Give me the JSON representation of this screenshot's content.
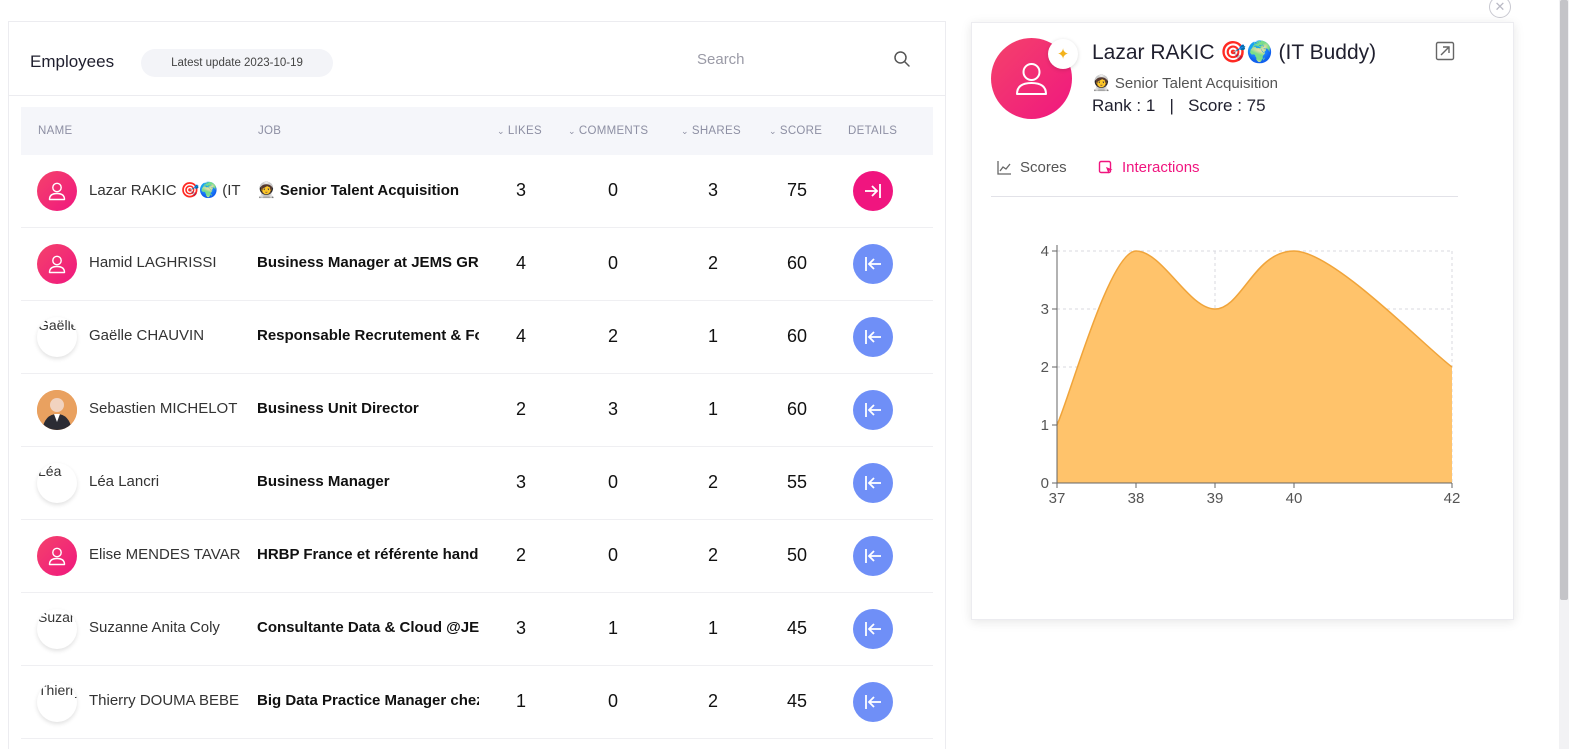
{
  "employees_panel": {
    "title": "Employees",
    "update_badge": "Latest update 2023-10-19",
    "search_placeholder": "Search",
    "columns": {
      "name": "NAME",
      "job": "JOB",
      "likes": "LIKES",
      "comments": "COMMENTS",
      "shares": "SHARES",
      "score": "SCORE",
      "details": "DETAILS"
    },
    "rows": [
      {
        "name": "Lazar RAKIC 🎯🌍 (IT Buddy)",
        "job": "🧑‍🚀 Senior Talent Acquisition",
        "likes": "3",
        "comments": "0",
        "shares": "3",
        "score": "75",
        "avatar": "pink",
        "alt": "",
        "active": true
      },
      {
        "name": "Hamid LAGHRISSI",
        "job": "Business Manager at JEMS GROUP",
        "likes": "4",
        "comments": "0",
        "shares": "2",
        "score": "60",
        "avatar": "pink",
        "alt": "",
        "active": false
      },
      {
        "name": "Gaëlle CHAUVIN",
        "job": "Responsable Recrutement & Formation",
        "likes": "4",
        "comments": "2",
        "shares": "1",
        "score": "60",
        "avatar": "broken",
        "alt": "Gaëlle",
        "active": false
      },
      {
        "name": "Sebastien MICHELOT",
        "job": "Business Unit Director",
        "likes": "2",
        "comments": "3",
        "shares": "1",
        "score": "60",
        "avatar": "photo",
        "alt": "",
        "active": false
      },
      {
        "name": "Léa Lancri",
        "job": "Business Manager",
        "likes": "3",
        "comments": "0",
        "shares": "2",
        "score": "55",
        "avatar": "broken",
        "alt": "Léa",
        "active": false
      },
      {
        "name": "Elise MENDES TAVARES",
        "job": "HRBP France et référente handicap",
        "likes": "2",
        "comments": "0",
        "shares": "2",
        "score": "50",
        "avatar": "pink",
        "alt": "",
        "active": false
      },
      {
        "name": "Suzanne Anita Coly",
        "job": "Consultante Data & Cloud @JEMS",
        "likes": "3",
        "comments": "1",
        "shares": "1",
        "score": "45",
        "avatar": "broken",
        "alt": "Suzanne",
        "active": false
      },
      {
        "name": "Thierry DOUMA BEBE",
        "job": "Big Data Practice Manager chez JEMS",
        "likes": "1",
        "comments": "0",
        "shares": "2",
        "score": "45",
        "avatar": "broken",
        "alt": "Thierry",
        "active": false
      }
    ]
  },
  "detail": {
    "name": "Lazar RAKIC 🎯🌍 (IT Buddy)",
    "job": "🧑‍🚀 Senior Talent Acquisition",
    "rank_label": "Rank : 1",
    "separator": "|",
    "score_label": "Score : 75",
    "tabs": {
      "scores": "Scores",
      "interactions": "Interactions"
    },
    "active_tab": "interactions"
  },
  "chart_data": {
    "type": "area",
    "x": [
      37,
      38,
      39,
      40,
      42
    ],
    "values": [
      1,
      4,
      3,
      4,
      2
    ],
    "xticks": [
      "37",
      "38",
      "39",
      "40",
      "42"
    ],
    "yticks": [
      "0",
      "1",
      "2",
      "3",
      "4"
    ],
    "ylim": [
      0,
      4
    ],
    "grid": true,
    "fill_color": "#ffc36b",
    "line_color": "#f0a43a"
  },
  "colors": {
    "accent_pink": "#f0157f",
    "details_blue": "#6f8ff7"
  }
}
